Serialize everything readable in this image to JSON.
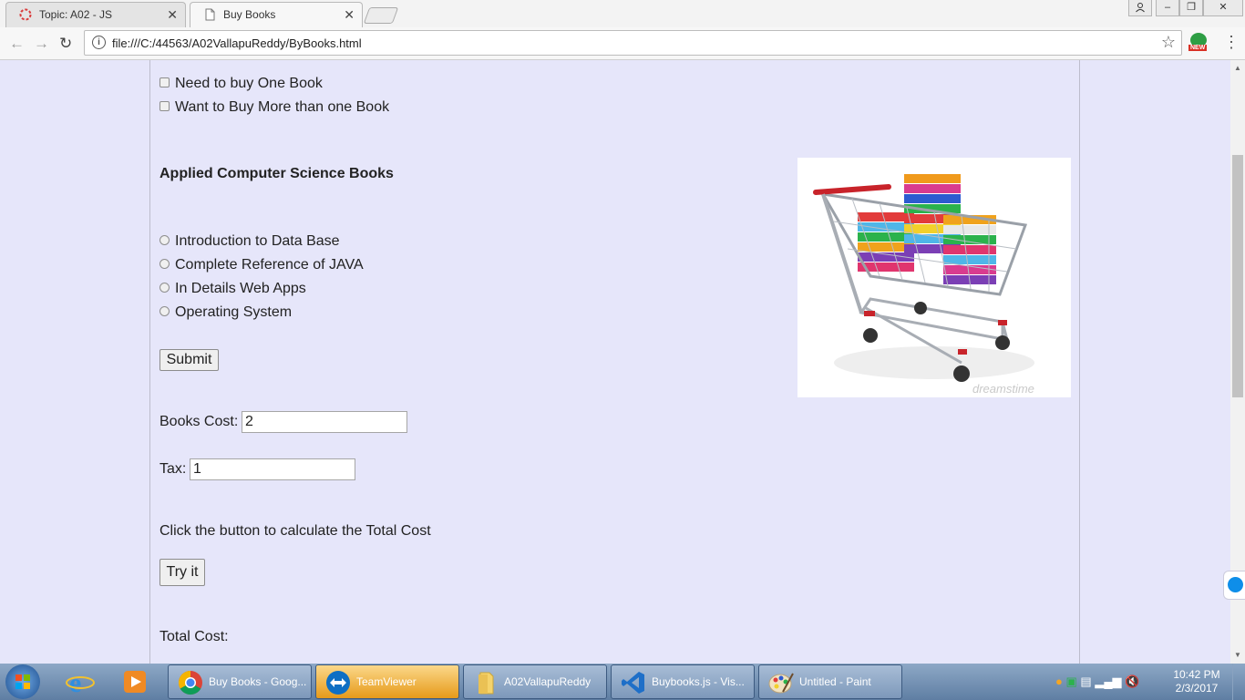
{
  "browser": {
    "tabs": [
      {
        "title": "Topic: A02 - JS",
        "active": false
      },
      {
        "title": "Buy Books",
        "active": true
      }
    ],
    "url": "file:///C:/44563/A02VallapuReddy/ByBooks.html",
    "extension_badge": "NEW"
  },
  "page": {
    "purchase_options": [
      "Need to buy One Book",
      "Want to Buy More than one Book"
    ],
    "section_heading": "Applied Computer Science Books",
    "books": [
      "Introduction to Data Base",
      "Complete Reference of JAVA",
      "In Details Web Apps",
      "Operating System"
    ],
    "submit_label": "Submit",
    "books_cost_label": "Books Cost:",
    "books_cost_value": "2",
    "tax_label": "Tax:",
    "tax_value": "1",
    "instruction": "Click the button to calculate the Total Cost",
    "try_label": "Try it",
    "total_label": "Total Cost:",
    "image_watermark": "dreamstime"
  },
  "taskbar": {
    "items": [
      {
        "label": "Buy Books - Goog...",
        "icon": "chrome-icon",
        "active": false
      },
      {
        "label": "TeamViewer",
        "icon": "teamviewer-icon",
        "active": true
      },
      {
        "label": "A02VallapuReddy",
        "icon": "folder-icon",
        "active": false
      },
      {
        "label": "Buybooks.js - Vis...",
        "icon": "vscode-icon",
        "active": false
      },
      {
        "label": "Untitled - Paint",
        "icon": "paint-icon",
        "active": false
      }
    ],
    "time": "10:42 PM",
    "date": "2/3/2017"
  },
  "colors": {
    "page_background": "#e6e6fa",
    "taskbar_active": "#e69a1a"
  }
}
